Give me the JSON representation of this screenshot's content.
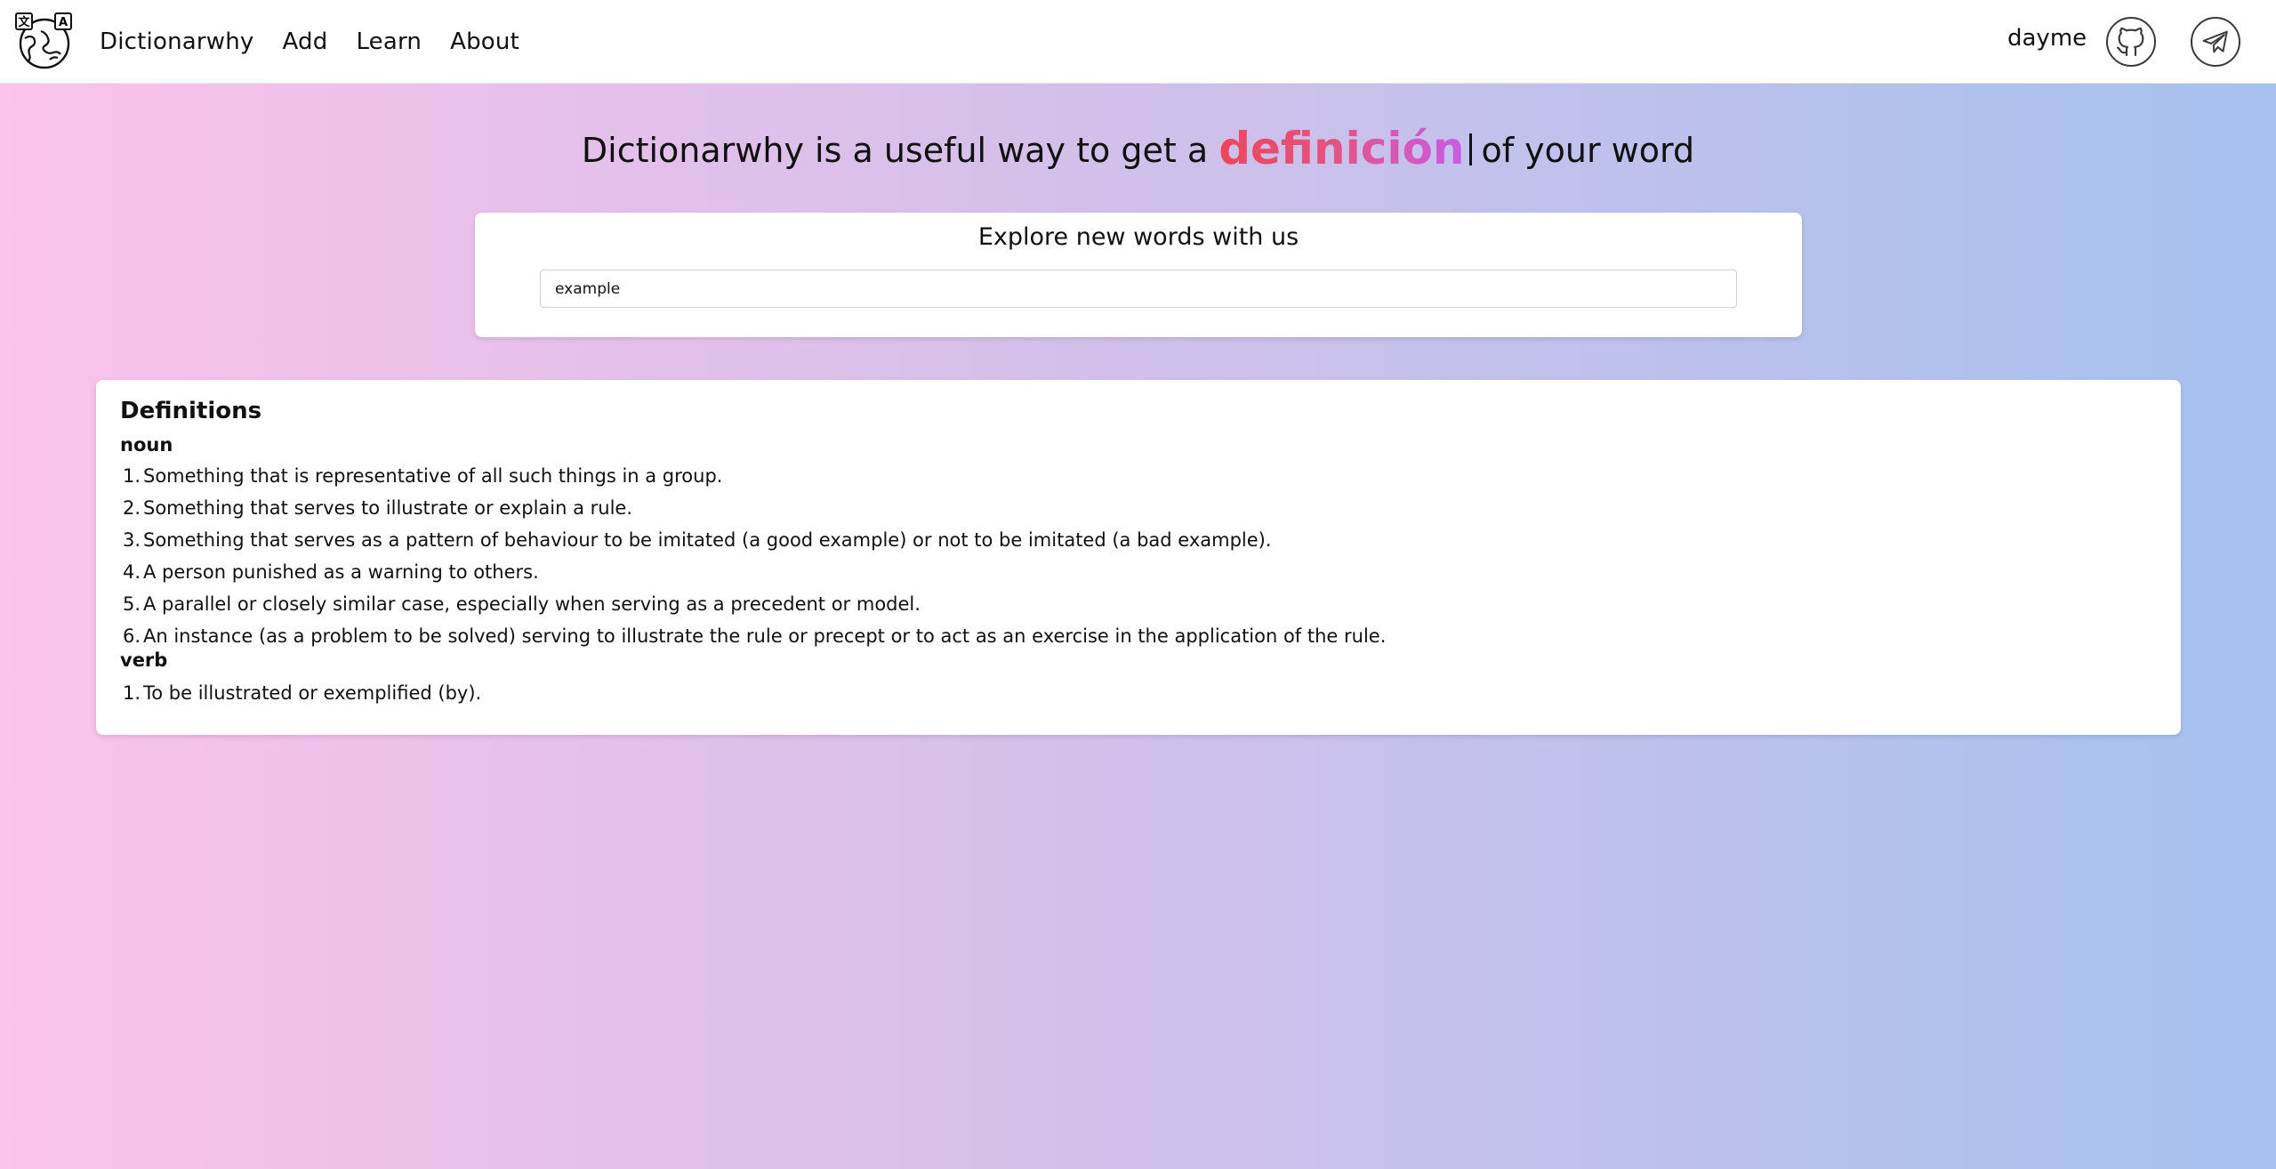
{
  "nav": {
    "brand": "Dictionarwhy",
    "links": [
      "Add",
      "Learn",
      "About"
    ],
    "username": "dayme",
    "icons": [
      "globe-translate-logo-icon",
      "github-icon",
      "telegram-icon"
    ]
  },
  "hero": {
    "prefix": "Dictionarwhy is a useful way to get a",
    "highlight": "definición",
    "suffix": "of your word",
    "accent_colors": [
      "#f0455a",
      "#c85ce6"
    ]
  },
  "search": {
    "title": "Explore new words with us",
    "value": "example"
  },
  "definitions": {
    "title": "Definitions",
    "noun": {
      "label": "noun",
      "items": [
        "Something that is representative of all such things in a group.",
        "Something that serves to illustrate or explain a rule.",
        "Something that serves as a pattern of behaviour to be imitated (a good example) or not to be imitated (a bad example).",
        "A person punished as a warning to others.",
        "A parallel or closely similar case, especially when serving as a precedent or model.",
        "An instance (as a problem to be solved) serving to illustrate the rule or precept or to act as an exercise in the application of the rule."
      ]
    },
    "verb": {
      "label": "verb",
      "items": [
        "To be illustrated or exemplified (by)."
      ]
    }
  },
  "colors": {
    "background_left": "#fbc2eb",
    "background_right": "#a6c1ee",
    "card": "#ffffff"
  }
}
